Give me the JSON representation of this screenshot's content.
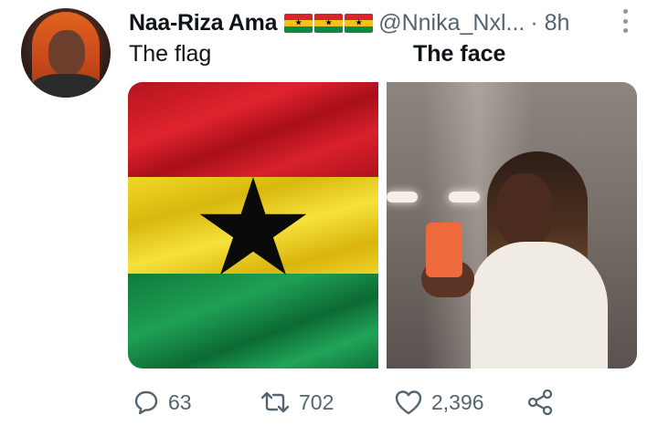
{
  "tweet": {
    "author_name": "Naa-Riza Ama",
    "author_flags": [
      "ghana-flag-emoji",
      "ghana-flag-emoji",
      "ghana-flag-emoji"
    ],
    "handle": "@Nnika_Nxl...",
    "time": "· 8h",
    "caption_left": "The flag",
    "caption_right": "The face",
    "images": [
      "ghana-flag-photo",
      "selfie-photo"
    ]
  },
  "actions": {
    "replies": "63",
    "retweets": "702",
    "likes": "2,396"
  },
  "colors": {
    "text": "#0f1419",
    "muted": "#536471",
    "flag_red": "#d8242b",
    "flag_yellow": "#f2c318",
    "flag_green": "#0f8a46"
  }
}
